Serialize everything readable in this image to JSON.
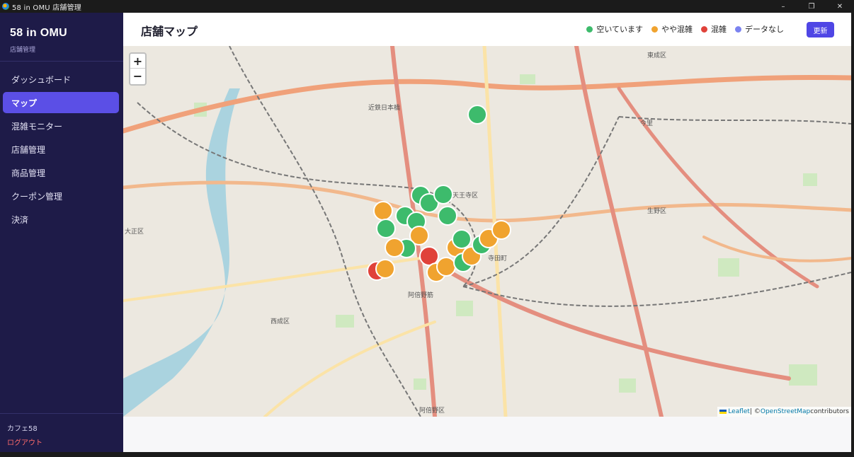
{
  "window": {
    "title": "58 in OMU 店舗管理",
    "controls": [
      "–",
      "❐",
      "✕"
    ]
  },
  "sidebar": {
    "brand": "58 in OMU",
    "brand_sub": "店舗管理",
    "items": [
      {
        "label": "ダッシュボード",
        "active": false
      },
      {
        "label": "マップ",
        "active": true
      },
      {
        "label": "混雑モニター",
        "active": false
      },
      {
        "label": "店舗管理",
        "active": false
      },
      {
        "label": "商品管理",
        "active": false
      },
      {
        "label": "クーポン管理",
        "active": false
      },
      {
        "label": "決済",
        "active": false
      }
    ],
    "store_name": "カフェ58",
    "logout": "ログアウト"
  },
  "header": {
    "title": "店舗マップ",
    "legend": [
      {
        "label": "空いています",
        "color": "#3dbb6c"
      },
      {
        "label": "やや混雑",
        "color": "#f0a32f"
      },
      {
        "label": "混雑",
        "color": "#e0423a"
      },
      {
        "label": "データなし",
        "color": "#7b83f0"
      }
    ],
    "refresh": "更新"
  },
  "map": {
    "zoom_in": "+",
    "zoom_out": "−",
    "attribution": {
      "leaflet": "Leaflet",
      "separator": " | © ",
      "osm": "OpenStreetMap",
      "suffix": " contributors"
    },
    "labels": [
      "東成区",
      "生野区",
      "大正区",
      "西成区",
      "阿倍野区",
      "天王寺区",
      "近鉄日本橋",
      "阿倍野筋",
      "今里",
      "寺田町"
    ],
    "status_colors": {
      "empty": "#3dbb6c",
      "busy": "#f0a32f",
      "crowded": "#e0423a"
    }
  }
}
